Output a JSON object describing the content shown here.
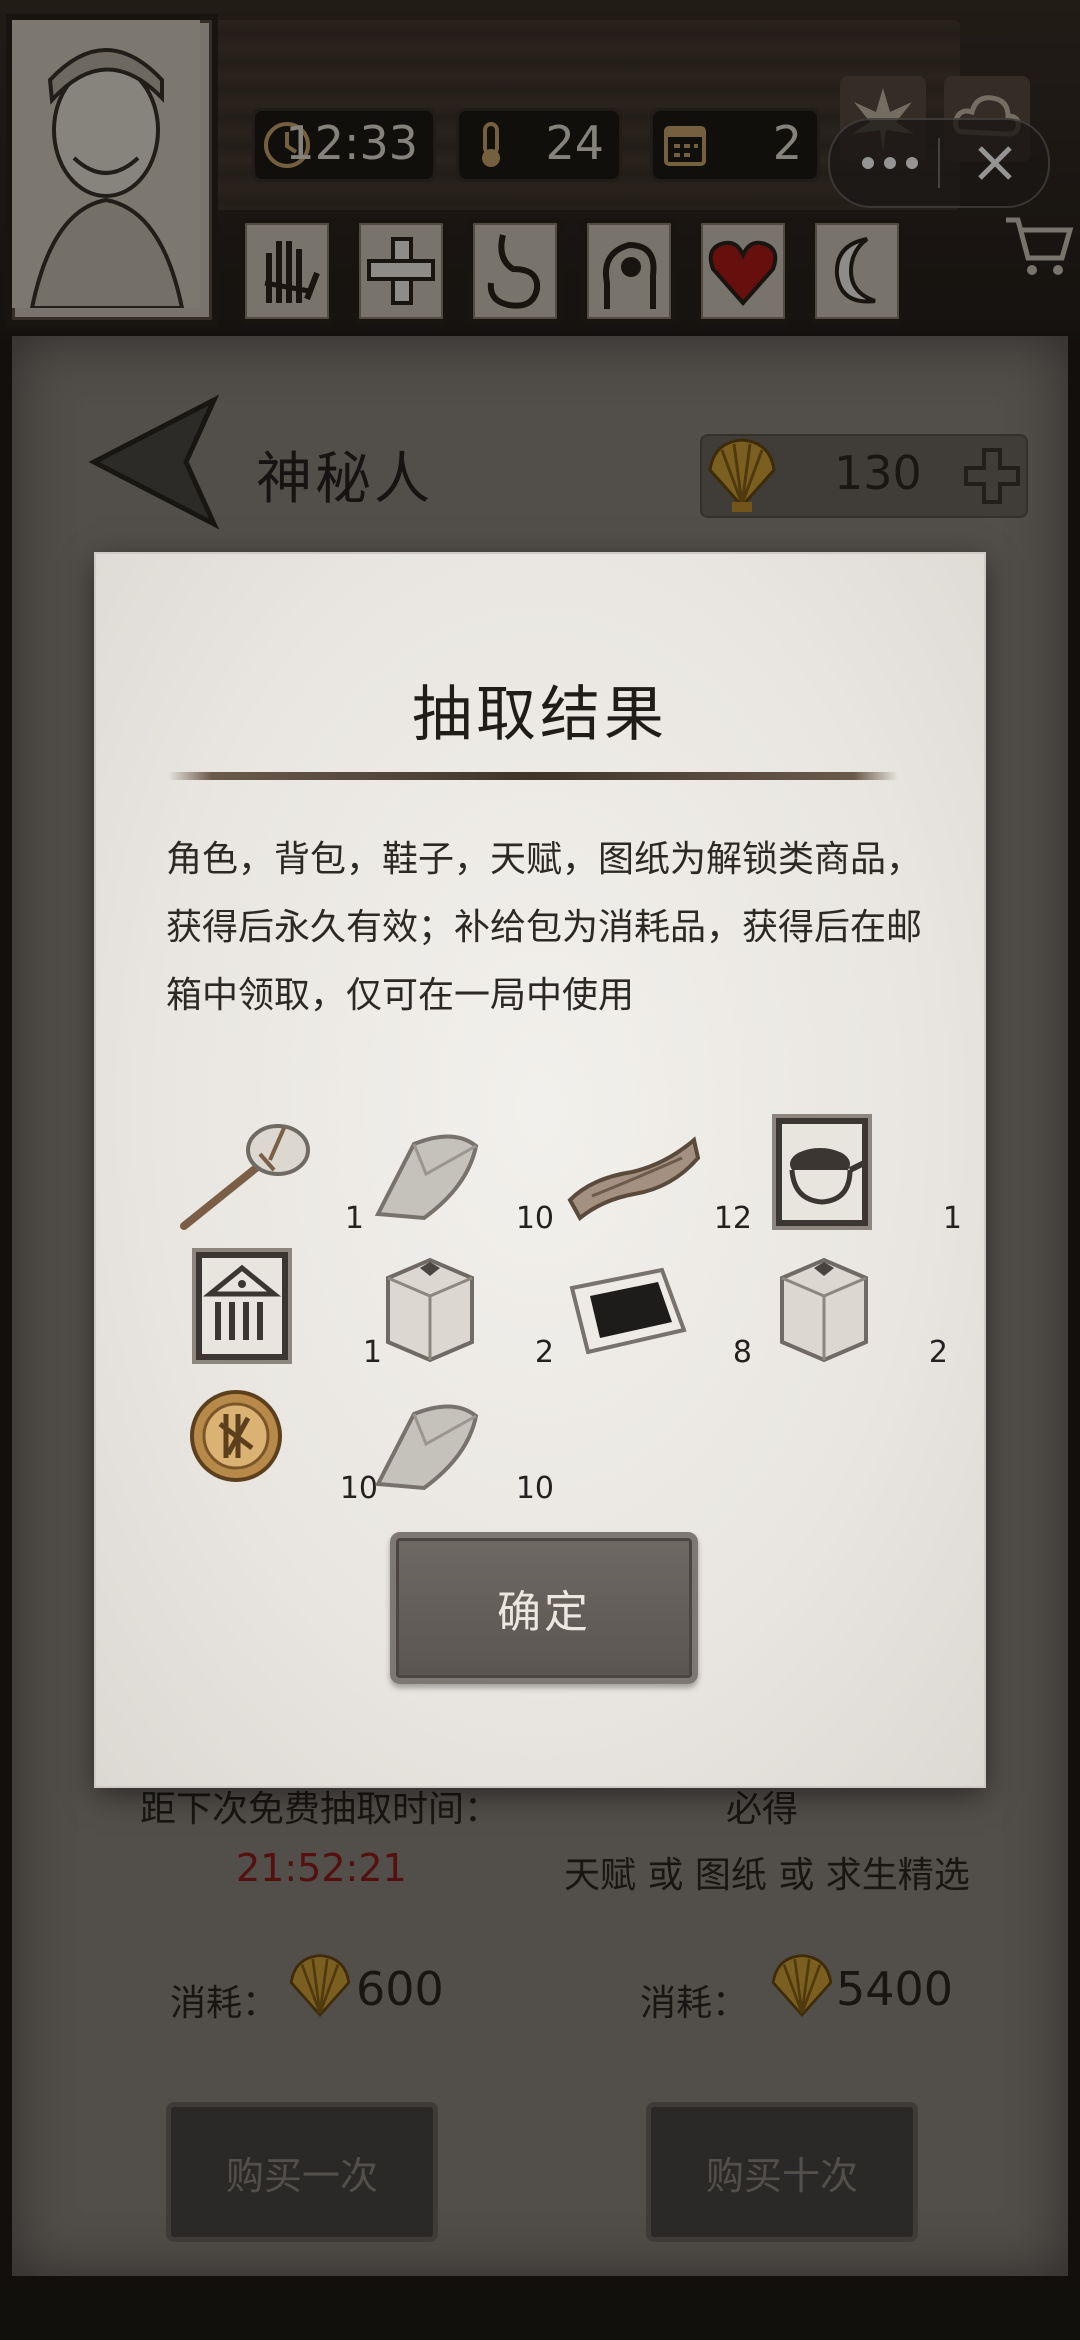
{
  "hud": {
    "time": "12:33",
    "temperature": "24",
    "day": "2"
  },
  "header": {
    "title": "神秘人",
    "shells": "130"
  },
  "shop": {
    "next_free_label": "距下次免费抽取时间：",
    "timer": "21:52:21",
    "guaranteed_label": "必得",
    "guaranteed_items": "天赋 或 图纸 或 求生精选",
    "cost_label": "消耗：",
    "cost_single": "600",
    "cost_ten": "5400",
    "buy_once": "购买一次",
    "buy_ten": "购买十次"
  },
  "modal": {
    "title": "抽取结果",
    "description": "角色，背包，鞋子，天赋，图纸为解锁类商品，获得后永久有效；补给包为消耗品，获得后在邮箱中领取，仅可在一局中使用",
    "confirm": "确定",
    "items": [
      {
        "icon": "stone-hammer-icon",
        "count": "1"
      },
      {
        "icon": "stone-icon",
        "count": "10"
      },
      {
        "icon": "wood-log-icon",
        "count": "12"
      },
      {
        "icon": "cooking-pot-card-icon",
        "count": "1"
      },
      {
        "icon": "building-card-icon",
        "count": "1"
      },
      {
        "icon": "supply-box-icon",
        "count": "2"
      },
      {
        "icon": "dark-cloth-icon",
        "count": "8"
      },
      {
        "icon": "supply-box-icon",
        "count": "2"
      },
      {
        "icon": "gold-coin-icon",
        "count": "10"
      },
      {
        "icon": "stone-icon",
        "count": "10"
      }
    ]
  },
  "colors": {
    "timer_red": "#8f1d19",
    "parchment": "#eeebe6",
    "button": "#625c57"
  }
}
